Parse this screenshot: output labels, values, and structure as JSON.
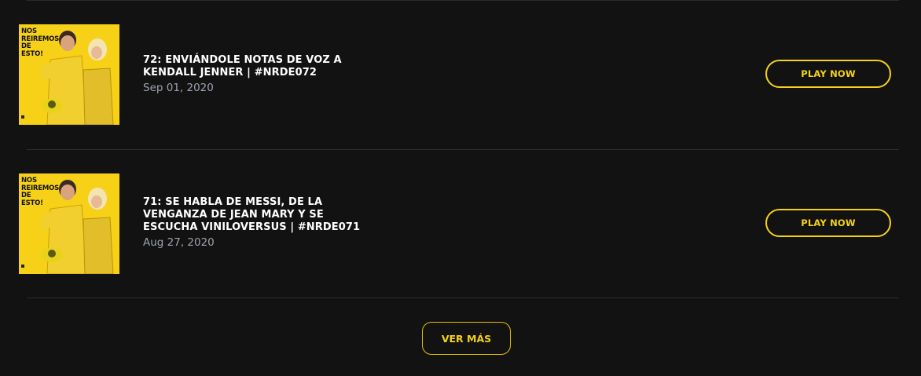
{
  "episodes": [
    {
      "cover_text": "NOS\nREIREMOS\nDE\nESTO!",
      "title": "72: ENVIÁNDOLE NOTAS DE VOZ A KENDALL JENNER | #NRDE072",
      "date": "Sep 01, 2020",
      "play_label": "PLAY NOW"
    },
    {
      "cover_text": "NOS\nREIREMOS\nDE\nESTO!",
      "title": "71: SE HABLA DE MESSI, DE LA VENGANZA DE JEAN MARY Y SE ESCUCHA VINILOVERSUS | #NRDE071",
      "date": "Aug 27, 2020",
      "play_label": "PLAY NOW"
    }
  ],
  "load_more_label": "VER MÁS",
  "colors": {
    "background": "#121212",
    "accent": "#f4d219",
    "cover_bg": "#f7d117",
    "date_text": "#9ea3b0",
    "divider": "#2b2b2b"
  }
}
